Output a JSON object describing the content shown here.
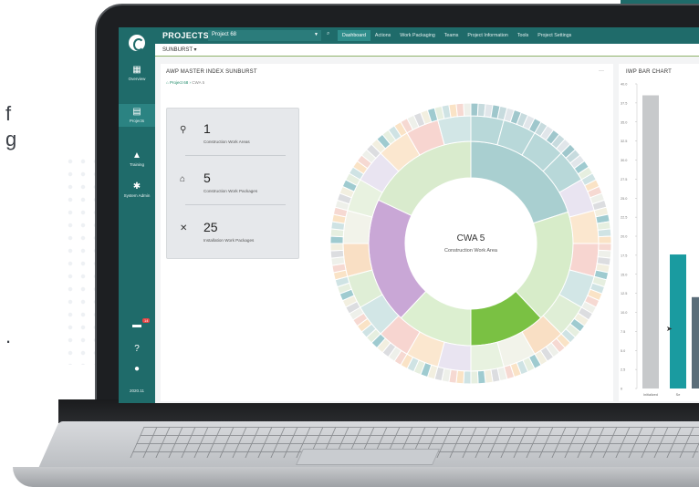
{
  "fragments": {
    "frag1": "f",
    "frag2": "g",
    "frag3": "."
  },
  "sidebar": {
    "items": [
      {
        "label": "Overview",
        "icon": "grid-icon"
      },
      {
        "label": "Projects",
        "icon": "clipboard-icon"
      },
      {
        "label": "Training",
        "icon": "graduation-cap-icon"
      },
      {
        "label": "System Admin",
        "icon": "gear-icon"
      },
      {
        "label": "",
        "icon": "notification-icon",
        "badge": "14"
      },
      {
        "label": "",
        "icon": "help-icon"
      },
      {
        "label": "",
        "icon": "user-icon"
      },
      {
        "label": "2020.11",
        "icon": ""
      }
    ]
  },
  "topbar": {
    "title": "PROJECTS",
    "project": "Project 68",
    "nav": [
      "Dashboard",
      "Actions",
      "Work Packaging",
      "Teams",
      "Project Information",
      "Tools",
      "Project Settings"
    ],
    "active_nav": "Dashboard"
  },
  "subbar": {
    "label": "SUNBURST ▾"
  },
  "sunburst_card": {
    "title": "AWP MASTER INDEX SUNBURST",
    "menu": "···",
    "breadcrumb": {
      "root": "Project 68",
      "current": "CWA 5"
    },
    "stats": [
      {
        "value": "1",
        "label": "Construction Work Areas"
      },
      {
        "value": "5",
        "label": "Construction Work Packages"
      },
      {
        "value": "25",
        "label": "Installation Work Packages"
      }
    ],
    "center_title": "CWA 5",
    "center_subtitle": "Construction Work Area"
  },
  "bar_card": {
    "title": "IWP BAR CHART"
  },
  "chart_data": {
    "type": "bar",
    "title": "IWP BAR CHART",
    "yticks": [
      "0",
      "2.5",
      "5.0",
      "7.5",
      "10.0",
      "12.5",
      "15.0",
      "17.5",
      "20.0",
      "22.5",
      "25.0",
      "27.5",
      "30.0",
      "32.5",
      "35.0",
      "37.5",
      "40.0"
    ],
    "ylim": [
      0,
      40
    ],
    "categories": [
      "Initialized",
      "Se",
      ""
    ],
    "values": [
      38.5,
      17.6,
      12.0
    ],
    "colors": [
      "#c7c9cb",
      "#1a9ba0",
      "#5b6e7a"
    ]
  }
}
